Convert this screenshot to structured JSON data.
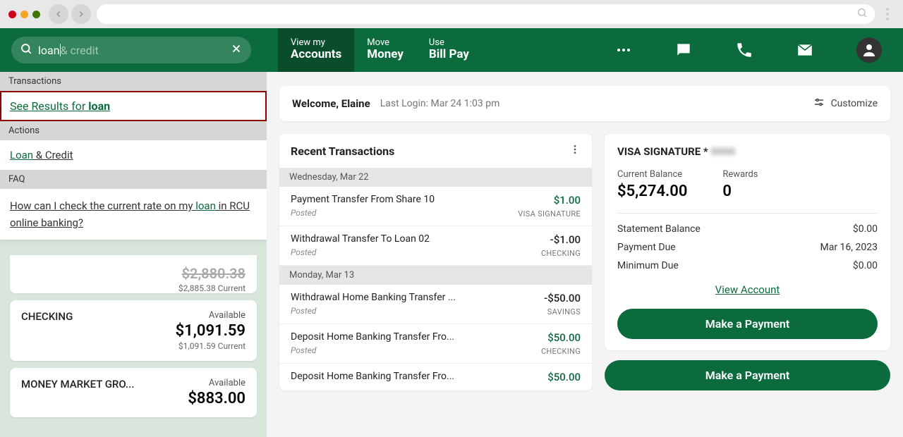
{
  "search": {
    "typed": "loan",
    "ghost": " & credit"
  },
  "tabs": [
    {
      "line1": "View my",
      "line2": "Accounts",
      "active": true
    },
    {
      "line1": "Move",
      "line2": "Money",
      "active": false
    },
    {
      "line1": "Use",
      "line2": "Bill Pay",
      "active": false
    }
  ],
  "search_results": {
    "section1_header": "Transactions",
    "see_results_prefix": "See Results for ",
    "see_results_term": "loan",
    "section2_header": "Actions",
    "action_link": "Loan",
    "action_link_rest": " & Credit",
    "section3_header": "FAQ",
    "faq_text_pre": "How can I check the current rate on my ",
    "faq_term": "loan",
    "faq_text_post": " in RCU online banking?"
  },
  "accounts_partial": {
    "amount_cut": "$2,880.38",
    "current": "$2,885.38 Current"
  },
  "accounts": [
    {
      "name": "CHECKING",
      "avail_label": "Available",
      "amount": "$1,091.59",
      "current": "$1,091.59 Current"
    },
    {
      "name": "MONEY MARKET GRO...",
      "avail_label": "Available",
      "amount": "$883.00",
      "current": ""
    }
  ],
  "welcome": {
    "greeting": "Welcome, Elaine",
    "last_login": "Last Login: Mar 24 1:03 pm",
    "customize": "Customize"
  },
  "recent": {
    "title": "Recent Transactions",
    "groups": [
      {
        "date": "Wednesday, Mar 22",
        "txns": [
          {
            "desc": "Payment Transfer From Share 10",
            "sub": "Posted",
            "amt": "$1.00",
            "pos": true,
            "acct": "VISA SIGNATURE"
          },
          {
            "desc": "Withdrawal Transfer To Loan 02",
            "sub": "Posted",
            "amt": "-$1.00",
            "pos": false,
            "acct": "CHECKING"
          }
        ]
      },
      {
        "date": "Monday, Mar 13",
        "txns": [
          {
            "desc": "Withdrawal Home Banking Transfer ...",
            "sub": "Posted",
            "amt": "-$50.00",
            "pos": false,
            "acct": "SAVINGS"
          },
          {
            "desc": "Deposit Home Banking Transfer Fro...",
            "sub": "Posted",
            "amt": "$50.00",
            "pos": true,
            "acct": "CHECKING"
          },
          {
            "desc": "Deposit Home Banking Transfer Fro...",
            "sub": "",
            "amt": "$50.00",
            "pos": true,
            "acct": ""
          }
        ]
      }
    ]
  },
  "visa": {
    "title_pre": "VISA SIGNATURE *",
    "title_masked": "0000",
    "current_balance_label": "Current Balance",
    "current_balance": "$5,274.00",
    "rewards_label": "Rewards",
    "rewards": "0",
    "rows": [
      {
        "label": "Statement Balance",
        "value": "$0.00"
      },
      {
        "label": "Payment Due",
        "value": "Mar 16, 2023"
      },
      {
        "label": "Minimum Due",
        "value": "$0.00"
      }
    ],
    "view_account": "View Account",
    "make_payment": "Make a Payment",
    "make_payment2": "Make a Payment"
  }
}
